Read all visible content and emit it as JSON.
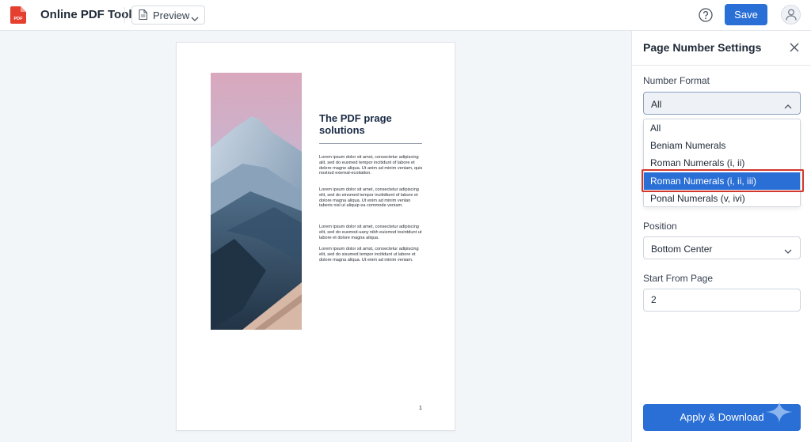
{
  "app": {
    "title": "Online PDF Tool",
    "logo_text": "PDF"
  },
  "toolbar": {
    "preview_label": "Preview",
    "save_label": "Save"
  },
  "document": {
    "title": "The PDF prage solutions",
    "paragraphs": [
      "Lorem ipsum dolor sit amst, consectetur adipiscing alit, sed do eusmed tempor incitidunt of labore et delere magne aliqua. Ut anim ad minim veniam, quis nostrud exereal-ecoitation.",
      "Lorem ipsum dolor sit amet, consectetur adipiscing elit, sed do einsmed tempor incitidkent of labore et dolore magna aliqua. Ut enim ad minim venlan taberis nisl ut aliquip ea commode veniam.",
      "Lorem ipsum dolor sit amet, consectetur adipiscing elit, sed do eusmod-uany nibh euismod tosintdunt ut labore et dolore magna aliqua.",
      "Lorem ipsum dolor sit amst, consectetur adipiscing elit, sed do sisumed tempor incitidunt ut labore et dolore magna aliqua. Ut enim ad minim veniam."
    ],
    "page_number": "1"
  },
  "panel": {
    "title": "Page Number Settings",
    "number_format": {
      "label": "Number Format",
      "value": "All",
      "options": [
        "All",
        "Beniam Numerals",
        "Roman Numerals (i, ii)",
        "Roman Numerals (i, ii, iii)",
        "Ponal Numerals (v, ivi)"
      ],
      "highlighted_index": 3
    },
    "position": {
      "label": "Position",
      "value": "Bottom Center"
    },
    "start_page": {
      "label": "Start From Page",
      "value": "2"
    },
    "apply_label": "Apply & Download"
  },
  "colors": {
    "accent": "#2a6fd6",
    "highlight_border": "#d2372c",
    "pdf_red": "#e5402f"
  }
}
